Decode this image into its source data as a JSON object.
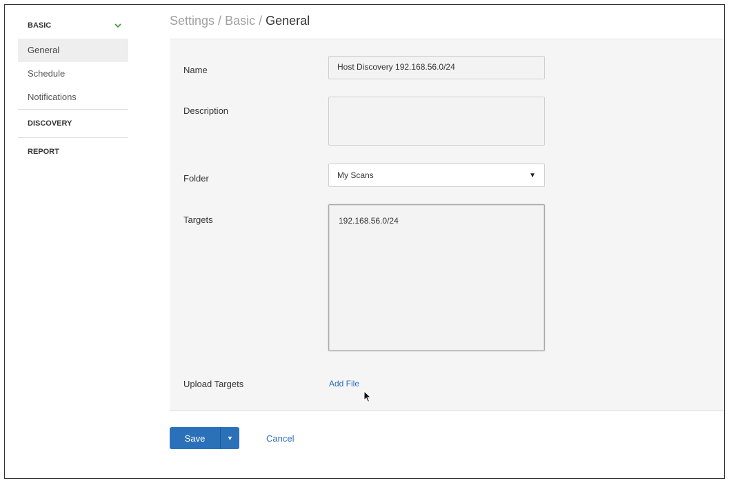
{
  "sidebar": {
    "basic_header": "BASIC",
    "items": [
      "General",
      "Schedule",
      "Notifications"
    ],
    "discovery_header": "DISCOVERY",
    "report_header": "REPORT"
  },
  "breadcrumb": {
    "part1": "Settings",
    "sep": " / ",
    "part2": "Basic",
    "current": "General"
  },
  "form": {
    "name_label": "Name",
    "name_value": "Host Discovery 192.168.56.0/24",
    "description_label": "Description",
    "description_value": "",
    "folder_label": "Folder",
    "folder_value": "My Scans",
    "targets_label": "Targets",
    "targets_value": "192.168.56.0/24",
    "upload_label": "Upload Targets",
    "add_file_label": "Add File"
  },
  "actions": {
    "save_label": "Save",
    "cancel_label": "Cancel"
  },
  "colors": {
    "primary": "#2b71b9",
    "link": "#2a6ebb",
    "check": "#3c9a3c"
  }
}
